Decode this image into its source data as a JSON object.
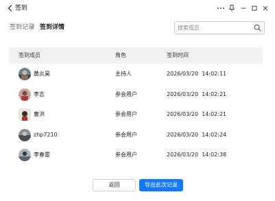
{
  "window": {
    "title": "签到"
  },
  "breadcrumb": {
    "parent": "签到记录",
    "separator": "/",
    "current": "签到详情"
  },
  "search": {
    "placeholder": "搜索成员",
    "value": ""
  },
  "table": {
    "headers": [
      "签到成员",
      "角色",
      "签到时间"
    ],
    "rows": [
      {
        "name": "黄炎昊",
        "role": "主持人",
        "date": "2026/03/20",
        "time": "14:02:11",
        "avatar": "avatar-photo-1"
      },
      {
        "name": "李志",
        "role": "参会用户",
        "date": "2026/03/20",
        "time": "14:02:21",
        "avatar": "avatar-photo-2"
      },
      {
        "name": "曹洪",
        "role": "参会用户",
        "date": "2026/03/20",
        "time": "14:02:21",
        "avatar": "avatar-photo-3"
      },
      {
        "name": "zhp7210",
        "role": "参会用户",
        "date": "2026/03/20",
        "time": "14:02:24",
        "avatar": "avatar-photo-4"
      },
      {
        "name": "李春雷",
        "role": "参会用户",
        "date": "2026/03/20",
        "time": "14:02:38",
        "avatar": "avatar-photo-5"
      }
    ]
  },
  "buttons": {
    "back_label": "返回",
    "export_label": "导出此次记录"
  },
  "colors": {
    "primary": "#1677ff",
    "header_bg": "#f2f2f2"
  },
  "icons": [
    "back-arrow-icon",
    "more-icon",
    "pin-icon",
    "minimize-icon",
    "maximize-icon",
    "close-icon",
    "search-icon"
  ]
}
